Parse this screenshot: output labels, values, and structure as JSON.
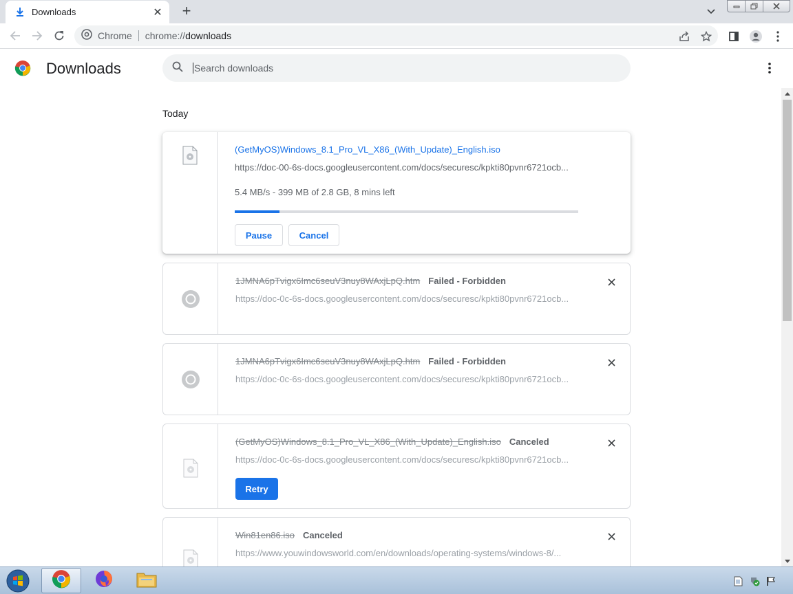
{
  "browser": {
    "tab_title": "Downloads",
    "tab_icon": "download-icon",
    "new_tab_label": "+",
    "window_controls": [
      "minimize",
      "restore",
      "close"
    ]
  },
  "toolbar": {
    "omnibox_site": "Chrome",
    "omnibox_url_scheme": "chrome://",
    "omnibox_url_host": "downloads"
  },
  "page": {
    "title": "Downloads",
    "search_placeholder": "Search downloads",
    "section_label": "Today",
    "accent_color": "#1a73e8"
  },
  "downloads": [
    {
      "file_name": "(GetMyOS)Windows_8.1_Pro_VL_X86_(With_Update)_English.iso",
      "url": "https://doc-00-6s-docs.googleusercontent.com/docs/securesc/kpkti80pvnr6721ocb...",
      "progress_text": "5.4 MB/s - 399 MB of 2.8 GB, 8 mins left",
      "progress_percent": 13,
      "pause_label": "Pause",
      "cancel_label": "Cancel",
      "state": "in_progress"
    },
    {
      "file_name": "1JMNA6pTvigx6Imc6seuV3nuy8WAxjLpQ.htm",
      "status": "Failed - Forbidden",
      "url": "https://doc-0c-6s-docs.googleusercontent.com/docs/securesc/kpkti80pvnr6721ocb...",
      "state": "failed"
    },
    {
      "file_name": "1JMNA6pTvigx6Imc6seuV3nuy8WAxjLpQ.htm",
      "status": "Failed - Forbidden",
      "url": "https://doc-0c-6s-docs.googleusercontent.com/docs/securesc/kpkti80pvnr6721ocb...",
      "state": "failed"
    },
    {
      "file_name": "(GetMyOS)Windows_8.1_Pro_VL_X86_(With_Update)_English.iso",
      "status": "Canceled",
      "url": "https://doc-0c-6s-docs.googleusercontent.com/docs/securesc/kpkti80pvnr6721ocb...",
      "retry_label": "Retry",
      "state": "canceled"
    },
    {
      "file_name": "Win81en86.iso",
      "status": "Canceled",
      "url": "https://www.youwindowsworld.com/en/downloads/operating-systems/windows-8/...",
      "state": "canceled"
    }
  ],
  "taskbar": {
    "items": [
      "start-orb-icon",
      "chrome-icon",
      "firefox-icon",
      "file-explorer-icon"
    ],
    "tray_icons": [
      "document-icon",
      "security-shield-icon",
      "action-center-flag-icon"
    ]
  }
}
